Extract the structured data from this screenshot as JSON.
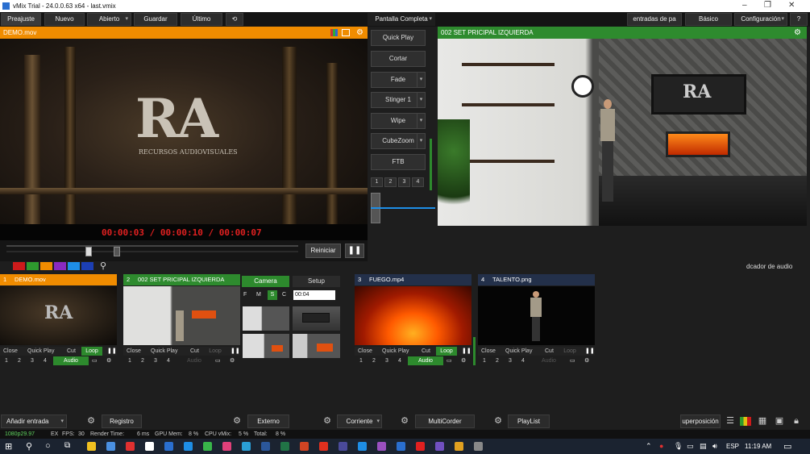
{
  "window": {
    "title": "vMix Trial - 24.0.0.63 x64 - last.vmix"
  },
  "menu": {
    "items": [
      "Preajuste",
      "Nuevo",
      "Abierto",
      "Guardar",
      "Último"
    ],
    "fullscreen": "Pantalla Completa",
    "entradas": "entradas de pa",
    "basico": "Básico",
    "configuracion": "Configuración",
    "help": "?"
  },
  "preview": {
    "title": "DEMO.mov",
    "logo_text": "RA",
    "logo_sub": "RECURSOS AUDIOVISUALES",
    "timecode": "00:00:03 / 00:00:10 / 00:00:07",
    "restart": "Reiniciar",
    "progress": 0.27
  },
  "output": {
    "title": "002 SET PRICIPAL IZQUIERDA",
    "logo_text": "RA"
  },
  "transitions": {
    "buttons": [
      "Quick Play",
      "Cortar",
      "Fade",
      "Stinger 1",
      "Wipe",
      "CubeZoom",
      "FTB"
    ],
    "numbers": [
      "1",
      "2",
      "3",
      "4"
    ]
  },
  "audio_mixer_label": "dcador de audio",
  "colors": {
    "swatches": [
      "#cc1b1b",
      "#2e9a2e",
      "#f08c00",
      "#8a2ac0",
      "#1e8ee6",
      "#1c3fb4"
    ]
  },
  "inputs": [
    {
      "num": "1",
      "title": "DEMO.mov",
      "color": "#f08c00",
      "loop_active": true,
      "audio_active": true,
      "logo": "RA"
    },
    {
      "num": "2",
      "title": "002 SET PRICIPAL IZQUIERDA",
      "color": "#2e8b2e",
      "loop_active": false,
      "audio_active": false
    },
    {
      "num": "3",
      "title": "FUEGO.mp4",
      "color": "#23304a",
      "loop_active": true,
      "audio_active": true
    },
    {
      "num": "4",
      "title": "TALENTO.png",
      "color": "#23304a",
      "loop_active": false,
      "audio_active": false
    }
  ],
  "input_controls": {
    "close": "Close",
    "quickplay": "Quick Play",
    "cut": "Cut",
    "loop": "Loop",
    "audio": "Audio",
    "numbers": [
      "1",
      "2",
      "3",
      "4"
    ]
  },
  "camera_panel": {
    "camera": "Camera",
    "setup": "Setup",
    "modes": [
      "F",
      "M",
      "S",
      "C"
    ],
    "time": "00:04"
  },
  "bottom": {
    "add_input": "Añadir entrada",
    "record": "Registro",
    "external": "Externo",
    "stream": "Corriente",
    "multicorder": "MultiCorder",
    "playlist": "PlayList",
    "overlay": "uperposición"
  },
  "status": {
    "format": "1080p29.97",
    "ex": "EX",
    "fps_label": "FPS:",
    "fps": "30",
    "render": "Render Time:",
    "render_val": "6 ms",
    "gpu": "GPU Mem:",
    "gpu_val": "8 %",
    "cpu": "CPU vMix:",
    "cpu_val": "5 %",
    "total": "Total:",
    "total_val": "8 %"
  },
  "taskbar": {
    "lang": "ESP",
    "time": "11:19 AM"
  }
}
